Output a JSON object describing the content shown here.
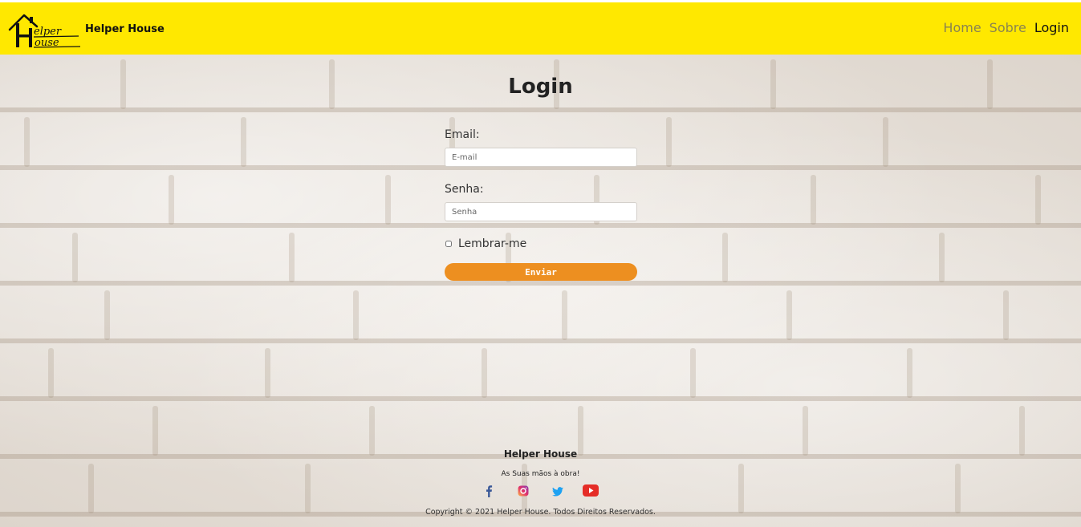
{
  "colors": {
    "navbar_bg": "#ffe800",
    "nav_link": "#8a8350",
    "nav_link_active": "#111111",
    "button_bg": "#ed8f20",
    "wall_bg": "#e8e2db"
  },
  "header": {
    "logo_icon": "helper-house-logo-icon",
    "brand_name": "Helper House",
    "nav": [
      {
        "label": "Home",
        "active": false
      },
      {
        "label": "Sobre",
        "active": false
      },
      {
        "label": "Login",
        "active": true
      }
    ]
  },
  "login": {
    "title": "Login",
    "email_label": "Email:",
    "email_placeholder": "E-mail",
    "password_label": "Senha:",
    "password_placeholder": "Senha",
    "remember_label": "Lembrar-me",
    "remember_checked": false,
    "submit_label": "Enviar"
  },
  "footer": {
    "title": "Helper House",
    "tagline": "As Suas mãos à obra!",
    "social": [
      {
        "name": "facebook-icon",
        "color": "#3b5998"
      },
      {
        "name": "instagram-icon",
        "color": "#d6249f"
      },
      {
        "name": "twitter-icon",
        "color": "#1da1f2"
      },
      {
        "name": "youtube-icon",
        "color": "#e52d27"
      }
    ],
    "copyright": "Copyright © 2021 Helper House. Todos Direitos Reservados."
  }
}
